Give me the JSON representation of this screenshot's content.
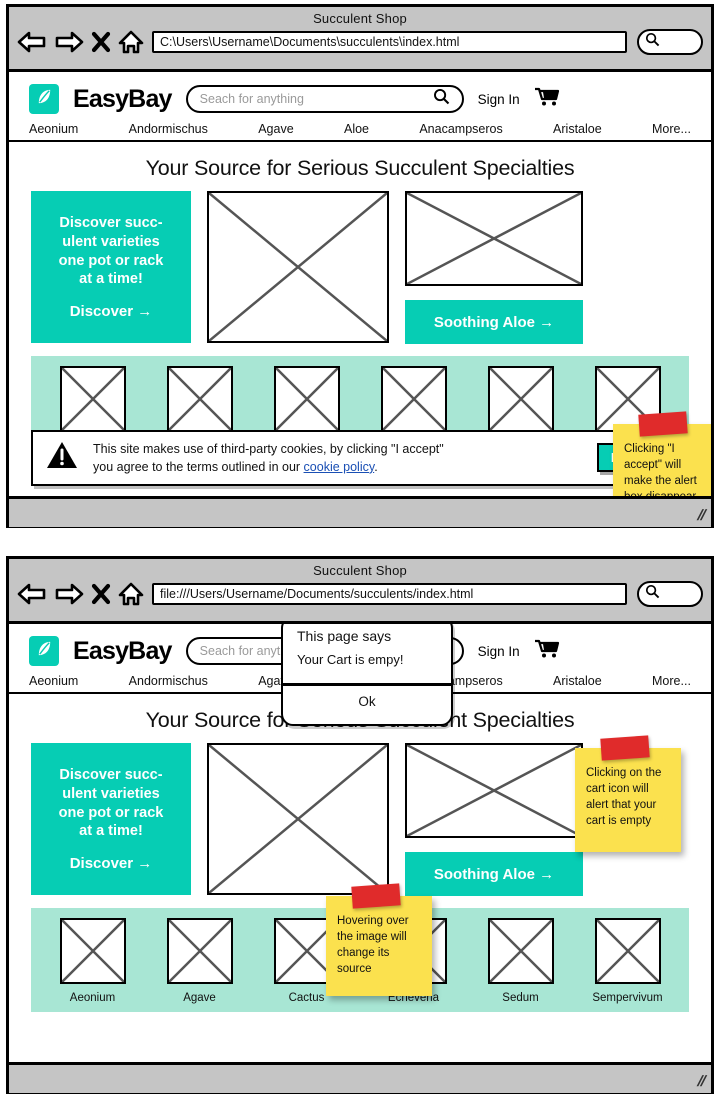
{
  "windows": [
    {
      "title": "Succulent Shop",
      "url": "C:\\Users\\Username\\Documents\\succulents\\index.html",
      "nav": {
        "back_icon": "back-arrow-icon",
        "forward_icon": "forward-arrow-icon",
        "stop_icon": "close-x-icon",
        "home_icon": "home-icon",
        "search_icon": "search-icon"
      }
    },
    {
      "title": "Succulent Shop",
      "url": "file:///Users/Username/Documents/succulents/index.html",
      "nav": {
        "back_icon": "back-arrow-icon",
        "forward_icon": "forward-arrow-icon",
        "stop_icon": "close-x-icon",
        "home_icon": "home-icon",
        "search_icon": "search-icon"
      }
    }
  ],
  "site": {
    "brand": "EasyBay",
    "logo_icon": "leaf-icon",
    "search_placeholder": "Seach for anything",
    "search_icon": "magnifier-icon",
    "sign_in": "Sign In",
    "cart_icon": "shopping-cart-icon",
    "nav_items": [
      "Aeonium",
      "Andormischus",
      "Agave",
      "Aloe",
      "Anacampseros",
      "Aristaloe",
      "More..."
    ],
    "hero_title": "Your Source for Serious Succulent Specialties",
    "promo": {
      "text": "Discover succ-\nulent varieties\none pot or rack\nat a time!",
      "cta": "Discover →"
    },
    "aloe_cta": "Soothing Aloe →",
    "gallery": [
      "Aeonium",
      "Agave",
      "Cactus",
      "Echeveria",
      "Sedum",
      "Sempervivum"
    ]
  },
  "cookie_banner": {
    "warning_icon": "warning-triangle-icon",
    "text_line1": "This site makes use of third-party cookies, by clicking \"I accept\"",
    "text_line2_pre": "you agree to the terms outlined in our ",
    "link_text": "cookie policy",
    "text_line2_post": ".",
    "accept_label": "I Accept"
  },
  "alert_dialog": {
    "title": "This page says",
    "message": "Your Cart is empy!",
    "ok_label": "Ok"
  },
  "sticky_notes": {
    "note1": "Clicking \"I accept\" will make the alert box disappear",
    "note2": "Clicking on the cart icon will alert that your cart is empty",
    "note3": "Hovering over the image will change its source"
  },
  "colors": {
    "teal": "#06cdb4",
    "mint": "#a8e6d4",
    "sticky_yellow": "#fbe14e",
    "tape_red": "#e02b2b",
    "chrome_gray": "#c5c5c5",
    "link_blue": "#1a4fb4"
  }
}
